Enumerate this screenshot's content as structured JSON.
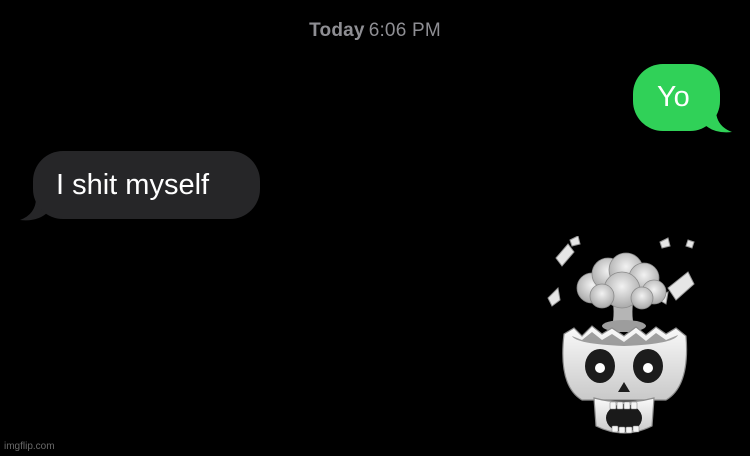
{
  "header": {
    "day_label": "Today",
    "time_label": "6:06 PM"
  },
  "messages": [
    {
      "direction": "sent",
      "text": "Yo"
    },
    {
      "direction": "received",
      "text": "I shit myself"
    }
  ],
  "reaction": {
    "icon": "exploding-head-skull-memoji-icon"
  },
  "watermark": "imgflip.com",
  "colors": {
    "background": "#000000",
    "sent_bubble": "#30d158",
    "received_bubble": "#262628",
    "timestamp": "#8e8e93"
  }
}
